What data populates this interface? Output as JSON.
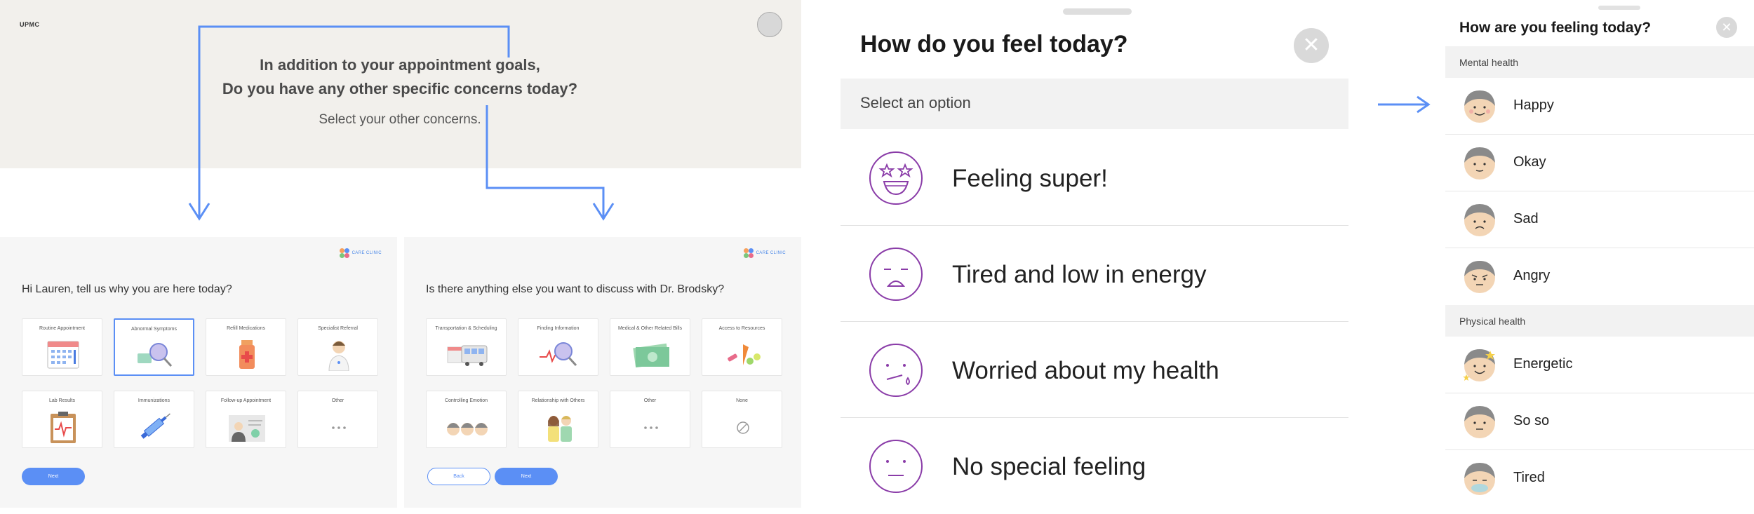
{
  "panel1": {
    "logo": "UPMC",
    "question_line1": "In addition to your appointment goals,",
    "question_line2": "Do you have any other specific concerns today?",
    "subtitle": "Select your other concerns.",
    "screen_a": {
      "brand": "CARE CLINIC",
      "question": "Hi Lauren, tell us why you are here today?",
      "tiles": [
        {
          "label": "Routine Appointment",
          "icon": "calendar-icon"
        },
        {
          "label": "Abnormal Symptoms",
          "icon": "magnifier-icon",
          "selected": true
        },
        {
          "label": "Refill Medications",
          "icon": "pill-bottle-icon"
        },
        {
          "label": "Specialist Referral",
          "icon": "doctor-icon"
        },
        {
          "label": "Lab Results",
          "icon": "clipboard-icon"
        },
        {
          "label": "Immunizations",
          "icon": "syringe-icon"
        },
        {
          "label": "Follow-up Appointment",
          "icon": "document-icon"
        },
        {
          "label": "Other",
          "icon": "ellipsis-icon"
        }
      ],
      "next_label": "Next"
    },
    "screen_b": {
      "brand": "CARE CLINIC",
      "question": "Is there anything else you want to discuss with Dr. Brodsky?",
      "tiles": [
        {
          "label": "Transportation & Scheduling",
          "icon": "bus-icon"
        },
        {
          "label": "Finding Information",
          "icon": "magnifier-icon"
        },
        {
          "label": "Medical & Other Related Bills",
          "icon": "money-icon"
        },
        {
          "label": "Access to Resources",
          "icon": "food-icon"
        },
        {
          "label": "Controlling Emotion",
          "icon": "faces-icon"
        },
        {
          "label": "Relationship with Others",
          "icon": "couple-icon"
        },
        {
          "label": "Other",
          "icon": "ellipsis-icon"
        },
        {
          "label": "None",
          "icon": "none-icon"
        }
      ],
      "back_label": "Back",
      "next_label": "Next"
    }
  },
  "panel2": {
    "title": "How do you feel today?",
    "close_icon": "close-icon",
    "select_prompt": "Select an option",
    "options": [
      {
        "label": "Feeling super!",
        "icon": "star-eyes-face-icon"
      },
      {
        "label": "Tired and low in energy",
        "icon": "tired-face-icon"
      },
      {
        "label": "Worried about my health",
        "icon": "worried-face-icon"
      },
      {
        "label": "No special feeling",
        "icon": "neutral-face-icon"
      }
    ],
    "accent": "#8a3ca8"
  },
  "panel3": {
    "title": "How are you feeling today?",
    "close_icon": "close-icon",
    "sections": [
      {
        "label": "Mental health",
        "items": [
          "Happy",
          "Okay",
          "Sad",
          "Angry"
        ]
      },
      {
        "label": "Physical health",
        "items": [
          "Energetic",
          "So so",
          "Tired"
        ]
      }
    ]
  },
  "colors": {
    "accent_blue": "#5b8ff5",
    "header_beige": "#f2f0ec",
    "flow_arrow": "#5b8ff5"
  }
}
